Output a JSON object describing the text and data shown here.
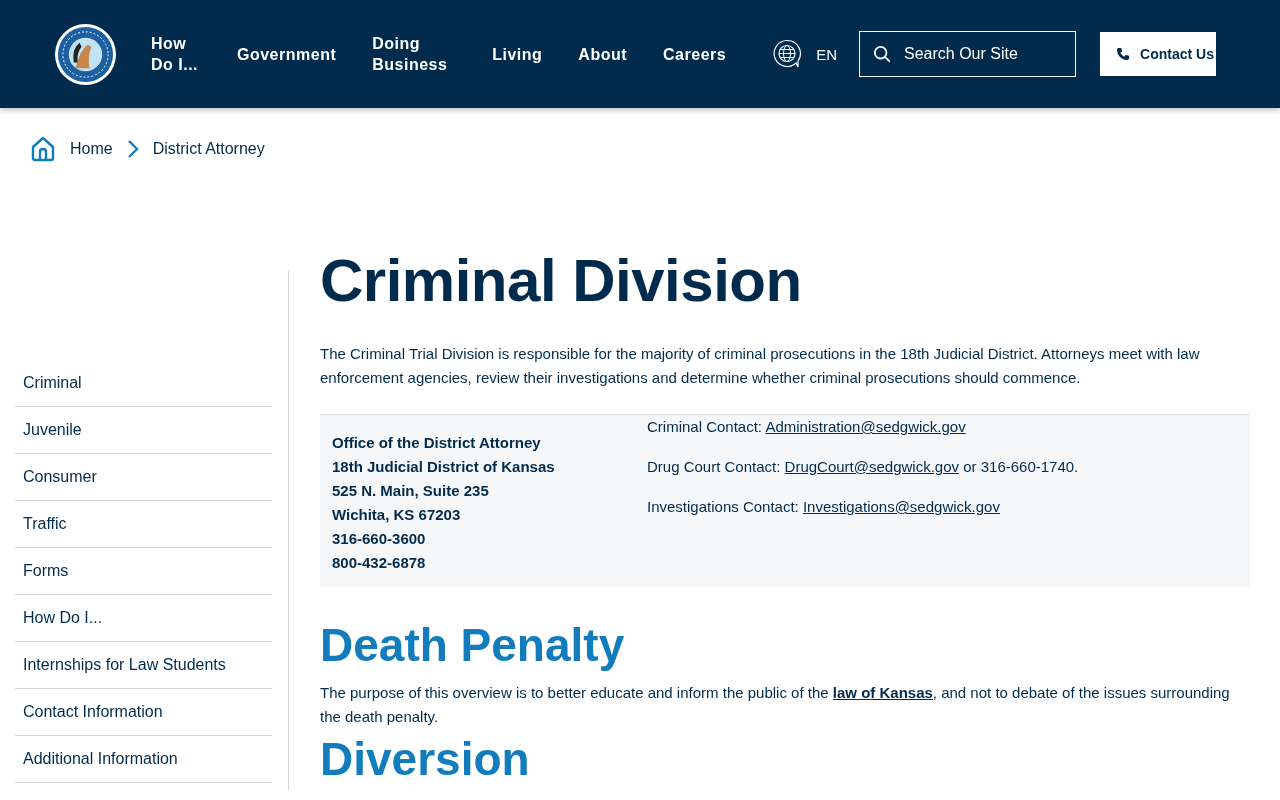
{
  "nav": [
    {
      "label": "How Do I..."
    },
    {
      "label": "Government"
    },
    {
      "label": "Doing Business"
    },
    {
      "label": "Living"
    },
    {
      "label": "About"
    },
    {
      "label": "Careers"
    }
  ],
  "language": "EN",
  "search": {
    "placeholder": "Search Our Site"
  },
  "contact_button": "Contact Us",
  "breadcrumb": [
    "Home",
    "District Attorney"
  ],
  "sidebar": {
    "items": [
      {
        "label": "Criminal"
      },
      {
        "label": "Juvenile"
      },
      {
        "label": "Consumer"
      },
      {
        "label": "Traffic"
      },
      {
        "label": "Forms"
      },
      {
        "label": "How Do I..."
      },
      {
        "label": "Internships for Law Students"
      },
      {
        "label": "Contact Information"
      },
      {
        "label": "Additional Information"
      }
    ]
  },
  "title": "Criminal Division",
  "intro": "The Criminal Trial Division is responsible for the majority of criminal prosecutions in the 18th Judicial District. Attorneys meet with law enforcement agencies, review their investigations and determine whether criminal prosecutions should commence.",
  "address": [
    "Office of the District Attorney",
    "18th Judicial District of Kansas",
    "525 N. Main, Suite 235",
    "Wichita, KS 67203",
    "316-660-3600",
    "800-432-6878"
  ],
  "contacts": [
    {
      "label": "Criminal Contact:",
      "email": "Administration@sedgwick.gov"
    },
    {
      "label": "Drug Court Contact:",
      "email": "DrugCourt@sedgwick.gov",
      "after": "or 316-660-1740."
    },
    {
      "label": "Investigations Contact:",
      "email": "Investigations@sedgwick.gov"
    }
  ],
  "sections": [
    {
      "heading": "Death Penalty",
      "before": "The purpose of this overview is to better educate and inform the public of the",
      "link": "law of Kansas",
      "after": ", and not to debate of the issues surrounding the death penalty."
    },
    {
      "heading": "Diversion"
    }
  ]
}
